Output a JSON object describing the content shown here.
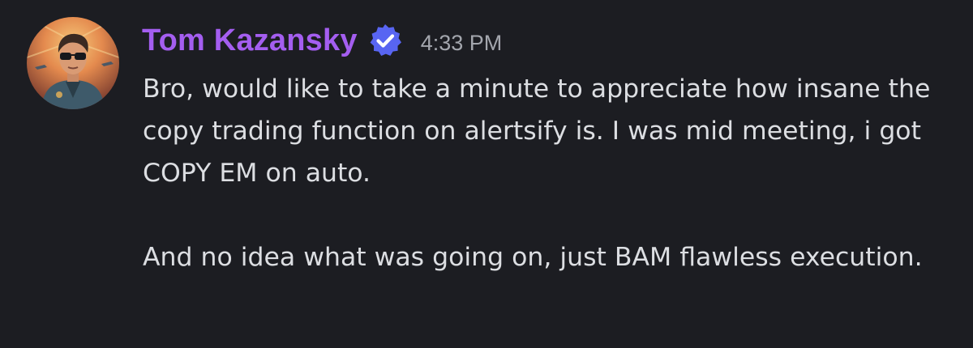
{
  "message": {
    "author": {
      "name": "Tom Kazansky",
      "name_color": "#a45ef0",
      "avatar_icon": "pilot-avatar-icon",
      "badge_icon": "verified-badge-icon",
      "badge_color": "#5865f2"
    },
    "timestamp": "4:33 PM",
    "paragraphs": [
      "Bro, would like to take a minute to appreciate how insane the copy trading function on alertsify is. I was mid meeting, i got COPY EM on auto.",
      "And no idea what was going on, just BAM flawless execution."
    ]
  },
  "theme": {
    "background": "#1c1d22",
    "text": "#dcdee2",
    "muted": "#a3a6ad"
  }
}
